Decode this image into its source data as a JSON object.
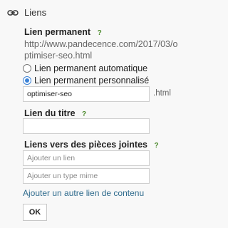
{
  "header": {
    "title": "Liens",
    "icon": "link-icon"
  },
  "permalink": {
    "label": "Lien permanent",
    "help": "?",
    "url": "http://www.pandecence.com/2017/03/optimiser-seo.html",
    "options": [
      {
        "label": "Lien permanent automatique",
        "selected": false
      },
      {
        "label": "Lien permanent personnalisé",
        "selected": true
      }
    ],
    "custom_value": "optimiser-seo",
    "suffix": ".html"
  },
  "title_link": {
    "label": "Lien du titre",
    "help": "?",
    "value": ""
  },
  "enclosures": {
    "label": "Liens vers des pièces jointes",
    "help": "?",
    "link_placeholder": "Ajouter un lien",
    "mime_placeholder": "Ajouter un type mime",
    "add_another": "Ajouter un autre lien de contenu"
  },
  "ok_label": "OK",
  "colors": {
    "accent": "#3b82d6",
    "help": "#4c8a2d",
    "link": "#2f6b8d"
  }
}
